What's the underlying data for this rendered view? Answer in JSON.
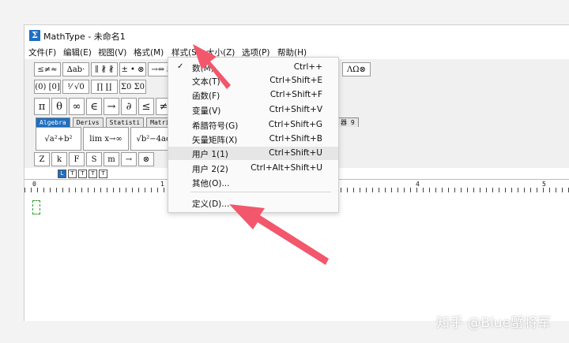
{
  "window": {
    "title": "MathType - 未命名1",
    "app_icon": "Σ"
  },
  "menubar": {
    "items": [
      {
        "label": "文件(F)"
      },
      {
        "label": "编辑(E)"
      },
      {
        "label": "视图(V)"
      },
      {
        "label": "格式(M)"
      },
      {
        "label": "样式(S)"
      },
      {
        "label": "大小(Z)"
      },
      {
        "label": "选项(P)"
      },
      {
        "label": "帮助(H)"
      }
    ]
  },
  "toolbar": {
    "row1": [
      "≤≠≈",
      "∆ab·",
      "∥ ∦ ∦",
      "± • ⊗",
      "→⇔↓"
    ],
    "row1_right": "ΛΩ⊗",
    "row2": [
      "(0) [0]",
      "⅟ √0",
      "∏ ∐",
      "Σ0 Σ0"
    ],
    "row3": [
      "π",
      "θ",
      "∞",
      "∈",
      "→",
      "∂",
      "≤",
      "≠"
    ],
    "tabs": [
      "Algebra",
      "Derivs",
      "Statisti",
      "Matri"
    ],
    "tab_right": "器 9",
    "templates": [
      "√a²+b²",
      "lim x→∞",
      "√b²−4ac"
    ],
    "row5": [
      "Z",
      "k",
      "F",
      "S",
      "m",
      "→",
      "⊗"
    ]
  },
  "tab_stops": [
    "L",
    "T",
    "T",
    "T",
    "T"
  ],
  "ruler": {
    "marks": [
      "0",
      "1",
      "4",
      "5"
    ]
  },
  "dropdown": {
    "items": [
      {
        "label": "数(M)",
        "shortcut": "Ctrl++",
        "checked": true
      },
      {
        "label": "文本(T)",
        "shortcut": "Ctrl+Shift+E"
      },
      {
        "label": "函数(F)",
        "shortcut": "Ctrl+Shift+F"
      },
      {
        "label": "变量(V)",
        "shortcut": "Ctrl+Shift+V"
      },
      {
        "label": "希腊符号(G)",
        "shortcut": "Ctrl+Shift+G"
      },
      {
        "label": "矢量矩阵(X)",
        "shortcut": "Ctrl+Shift+B"
      },
      {
        "label": "用户 1(1)",
        "shortcut": "Ctrl+Shift+U"
      },
      {
        "label": "用户 2(2)",
        "shortcut": "Ctrl+Alt+Shift+U"
      },
      {
        "label": "其他(O)...",
        "shortcut": ""
      },
      {
        "label": "定义(D)...",
        "shortcut": ""
      }
    ],
    "check_glyph": "✓"
  },
  "annotation": {
    "arrow_color": "#f2576b"
  },
  "watermark": "知乎 @Blue蟹将军"
}
